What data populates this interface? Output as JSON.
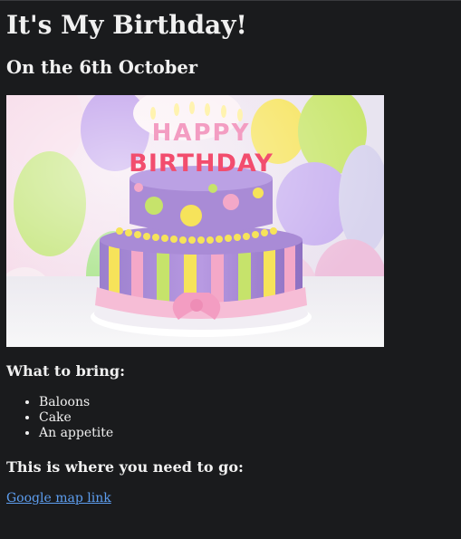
{
  "page": {
    "title": "It's My Birthday!",
    "subtitle": "On the 6th October"
  },
  "image": {
    "subject": "birthday-cake-photo",
    "topper_text": [
      "HAPPY",
      "BIRTHDAY"
    ],
    "colors": {
      "cake_purple": "#a98bd6",
      "ribbon_pink": "#f3a9c9",
      "balloon_green": "#b9e36a",
      "balloon_yellow": "#f6e35a",
      "balloon_purple": "#9b78e0"
    }
  },
  "bring": {
    "heading": "What to bring:",
    "items": [
      "Baloons",
      "Cake",
      "An appetite"
    ]
  },
  "directions": {
    "heading": "This is where you need to go:",
    "link_label": "Google map link"
  },
  "colors": {
    "background": "#1a1b1d",
    "text": "#f0f0f0",
    "link": "#5d9ef0"
  }
}
